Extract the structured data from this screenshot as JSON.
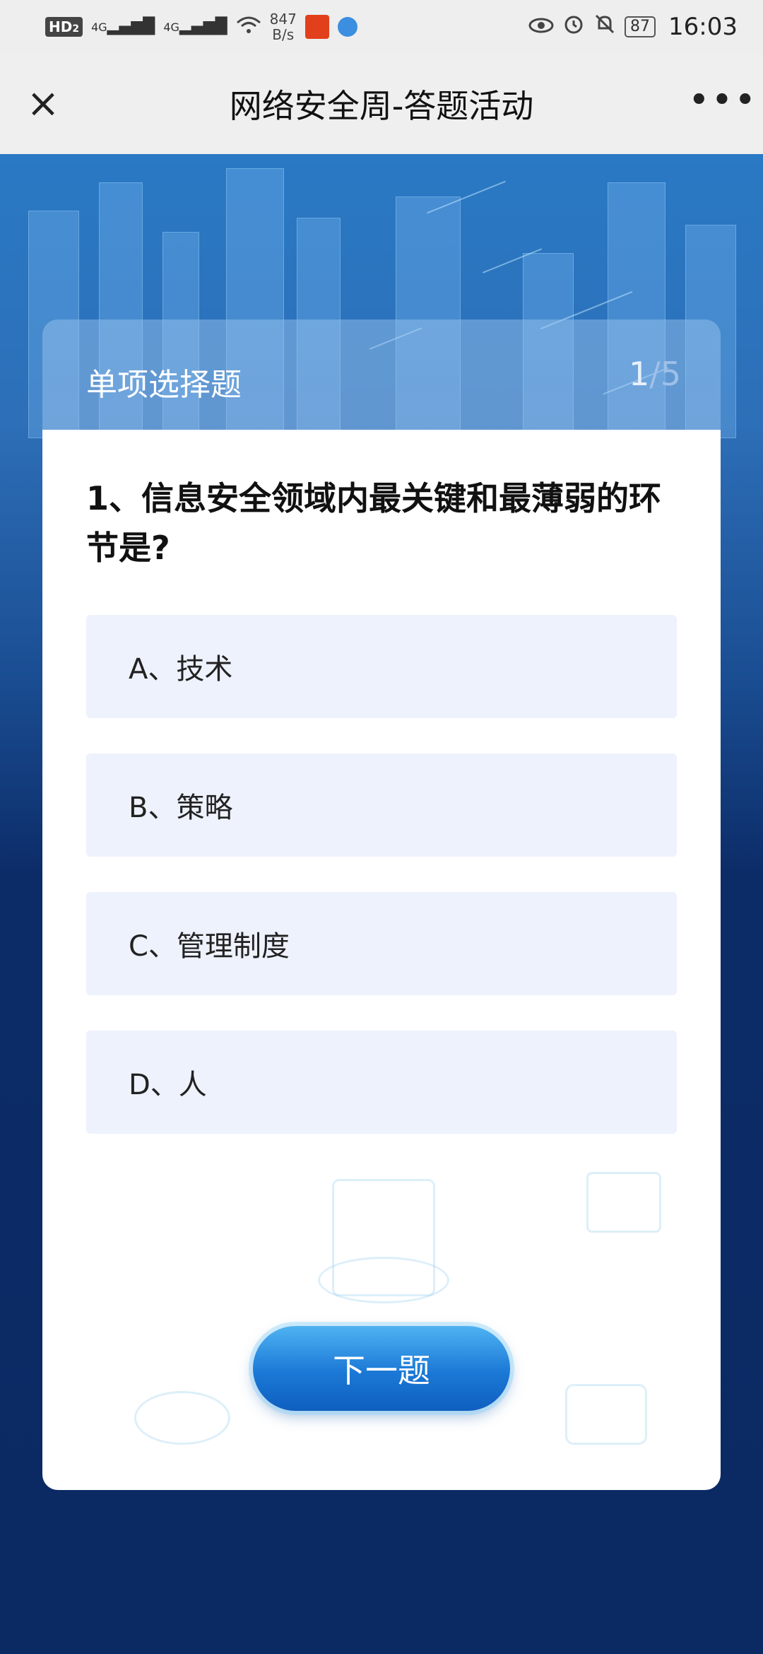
{
  "status_bar": {
    "hd_label": "HD",
    "hd_sub": "2",
    "signal1": "4G",
    "signal2": "4G",
    "speed_value": "847",
    "speed_unit": "B/s",
    "battery": "87",
    "time": "16:03",
    "icons": [
      "wifi-icon",
      "eye-icon",
      "alarm-icon",
      "mute-icon"
    ]
  },
  "nav": {
    "title": "网络安全周-答题活动",
    "close_icon": "×",
    "more_icon": "•••"
  },
  "card": {
    "type_label": "单项选择题",
    "progress_current": "1",
    "progress_total": "/5",
    "question": "1、信息安全领域内最关键和最薄弱的环节是?",
    "options": [
      {
        "label": "A、技术"
      },
      {
        "label": "B、策略"
      },
      {
        "label": "C、管理制度"
      },
      {
        "label": "D、人"
      }
    ],
    "next_button": "下一题"
  },
  "colors": {
    "background_top": "#2a79c4",
    "background_bottom": "#0b2a63",
    "option_bg": "#eef2fd",
    "button_blue": "#1b78d6"
  }
}
